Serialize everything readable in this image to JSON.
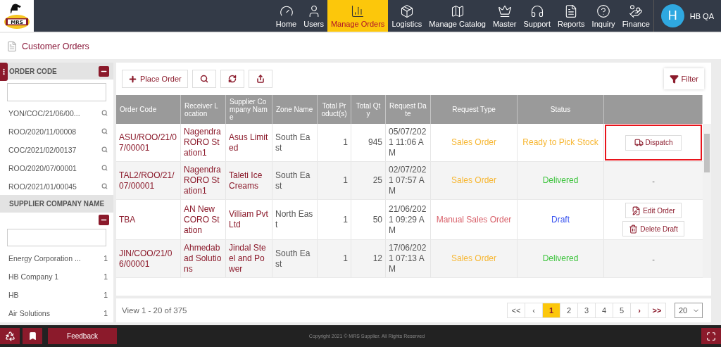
{
  "logo": {
    "text": "MRS"
  },
  "nav": [
    {
      "label": "Home",
      "selected": false
    },
    {
      "label": "Users",
      "selected": false
    },
    {
      "label": "Manage Orders",
      "selected": true
    },
    {
      "label": "Logistics",
      "selected": false
    },
    {
      "label": "Manage Catalog",
      "selected": false
    },
    {
      "label": "Master",
      "selected": false
    },
    {
      "label": "Support",
      "selected": false
    },
    {
      "label": "Reports",
      "selected": false
    },
    {
      "label": "Inquiry",
      "selected": false
    },
    {
      "label": "Finance",
      "selected": false
    }
  ],
  "user": {
    "initial": "H",
    "name": "HB QA"
  },
  "page_title": "Customer Orders",
  "sidebar": {
    "sections": [
      {
        "title": "ORDER CODE",
        "kind": "search",
        "items": [
          {
            "label": "YON/COC/21/06/00..."
          },
          {
            "label": "ROO/2020/11/00008"
          },
          {
            "label": "COC/2021/02/00137"
          },
          {
            "label": "ROO/2020/07/00001"
          },
          {
            "label": "ROO/2021/01/00045"
          }
        ]
      },
      {
        "title": "SUPPLIER COMPANY NAME",
        "kind": "count",
        "items": [
          {
            "label": "Energy Corporation ...",
            "count": "1"
          },
          {
            "label": "HB Company 1",
            "count": "1"
          },
          {
            "label": "HB",
            "count": "1"
          },
          {
            "label": "Air Solutions",
            "count": "1"
          }
        ]
      }
    ]
  },
  "toolbar": {
    "place_order": "Place Order",
    "filter": "Filter"
  },
  "table": {
    "columns": [
      "Order Code",
      "Receiver Location",
      "Supplier Company Name",
      "Zone Name",
      "Total Product(s)",
      "Total Qty",
      "Request Date",
      "Request Type",
      "Status"
    ],
    "rows": [
      {
        "order_code": "ASU/ROO/21/07/00001",
        "receiver": "Nagendra RORO Station1",
        "supplier": "Asus Limited",
        "zone": "South East",
        "products": "1",
        "qty": "945",
        "date": "05/07/2021 11:06 AM",
        "request_type": {
          "text": "Sales Order",
          "color": "#f7b733"
        },
        "status": {
          "text": "Ready to Pick Stock",
          "color": "#f7b733"
        },
        "actions": [
          {
            "kind": "dispatch",
            "label": "Dispatch"
          }
        ],
        "highlighted": true
      },
      {
        "order_code": "TAL2/ROO/21/07/00001",
        "receiver": "Nagendra RORO Station1",
        "supplier": "Taleti Ice Creams",
        "zone": "South East",
        "products": "1",
        "qty": "25",
        "date": "02/07/2021 07:57 AM",
        "request_type": {
          "text": "Sales Order",
          "color": "#f7b733"
        },
        "status": {
          "text": "Delivered",
          "color": "#3ec43e"
        },
        "actions": [
          {
            "kind": "none",
            "label": "-"
          }
        ],
        "highlighted": false
      },
      {
        "order_code": "TBA",
        "receiver": "AN New CORO Station",
        "supplier": "Villiam Pvt Ltd",
        "zone": "North East",
        "products": "1",
        "qty": "50",
        "date": "21/06/2021 09:29 AM",
        "request_type": {
          "text": "Manual Sales Order",
          "color": "#d9626b"
        },
        "status": {
          "text": "Draft",
          "color": "#3b55f0"
        },
        "actions": [
          {
            "kind": "edit",
            "label": "Edit Order"
          },
          {
            "kind": "delete",
            "label": "Delete Draft"
          }
        ],
        "highlighted": false
      },
      {
        "order_code": "JIN/COO/21/06/00001",
        "receiver": "Ahmedabad Solutions",
        "supplier": "Jindal Steel and Power",
        "zone": "South East",
        "products": "1",
        "qty": "12",
        "date": "17/06/2021 07:13 AM",
        "request_type": {
          "text": "Sales Order",
          "color": "#f7b733"
        },
        "status": {
          "text": "Delivered",
          "color": "#3ec43e"
        },
        "actions": [
          {
            "kind": "none",
            "label": "-"
          }
        ],
        "highlighted": false
      }
    ]
  },
  "pagination": {
    "summary": "View 1 - 20 of 375",
    "first": "<<",
    "prev": "‹",
    "pages": [
      {
        "label": "1",
        "selected": true
      },
      {
        "label": "2",
        "selected": false
      },
      {
        "label": "3",
        "selected": false
      },
      {
        "label": "4",
        "selected": false
      },
      {
        "label": "5",
        "selected": false
      }
    ],
    "next": "›",
    "last": ">>",
    "page_size": "20"
  },
  "footer": {
    "feedback": "Feedback",
    "copyright": "Copyright 2021 © MRS Supplier. All Rights Reserved"
  }
}
